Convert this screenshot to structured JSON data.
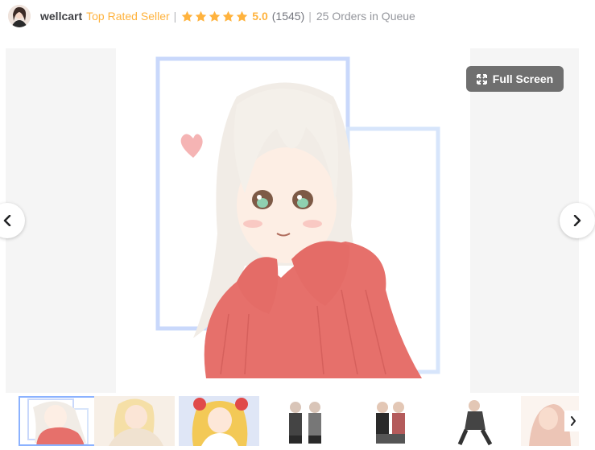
{
  "seller": {
    "name": "wellcart",
    "level": "Top Rated Seller",
    "separator": "|",
    "rating": "5.0",
    "rating_count": "(1545)",
    "queue": "25 Orders in Queue",
    "star_color": "#ffb33e",
    "level_color": "#ffb33e"
  },
  "gallery": {
    "fullscreen_label": "Full Screen",
    "prev_icon": "chevron-left-icon",
    "next_icon": "chevron-right-icon"
  },
  "thumbnails": {
    "count": 7,
    "active_index": 0
  }
}
